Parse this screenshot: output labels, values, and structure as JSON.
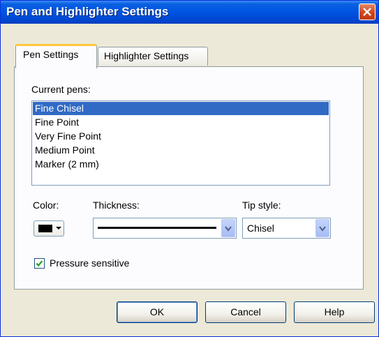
{
  "window": {
    "title": "Pen and Highlighter Settings"
  },
  "tabs": [
    {
      "label": "Pen Settings",
      "active": true
    },
    {
      "label": "Highlighter Settings",
      "active": false
    }
  ],
  "pens": {
    "label": "Current pens:",
    "items": [
      "Fine Chisel",
      "Fine Point",
      "Very Fine Point",
      "Medium Point",
      "Marker (2 mm)"
    ],
    "selected": "Fine Chisel"
  },
  "color": {
    "label": "Color:",
    "value": "#000000"
  },
  "thickness": {
    "label": "Thickness:"
  },
  "tip_style": {
    "label": "Tip style:",
    "value": "Chisel"
  },
  "pressure": {
    "label": "Pressure sensitive",
    "checked": true
  },
  "buttons": {
    "ok": "OK",
    "cancel": "Cancel",
    "help": "Help"
  },
  "colors": {
    "titlebar": "#0054e3",
    "selection": "#316ac5",
    "dialog": "#ece9d8",
    "close": "#d0441c"
  }
}
